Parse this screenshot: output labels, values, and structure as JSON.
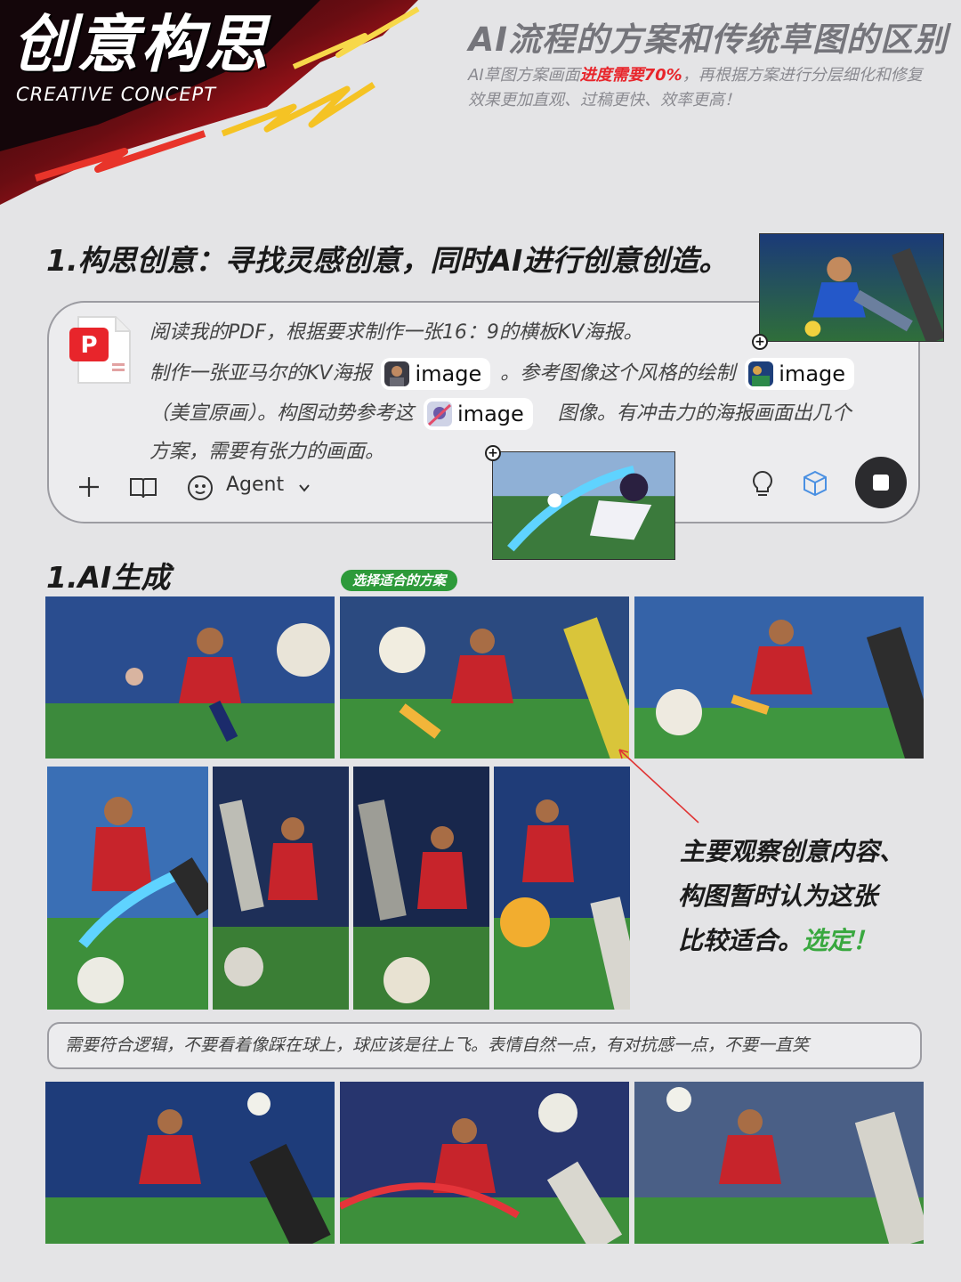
{
  "header": {
    "title": "创意构思",
    "subtitle": "CREATIVE CONCEPT",
    "right_title": "AI流程的方案和传统草图的区别",
    "desc_prefix": "AI草图方案画面",
    "desc_highlight": "进度需要70%",
    "desc_suffix": "，再根据方案进行分层细化和修复",
    "desc_line2": "效果更加直观、过稿更快、效率更高！"
  },
  "section1": {
    "heading": "1.构思创意：寻找灵感创意，同时AI进行创意创造。"
  },
  "prompt": {
    "line1": "阅读我的PDF，根据要求制作一张16：9的横板KV海报。",
    "line2_a": "制作一张亚马尔的KV海报",
    "chip1": "image",
    "line2_b": "。参考图像这个风格的绘制",
    "chip2": "image",
    "line3_a": "（美宣原画）。构图动势参考这",
    "chip3": "image",
    "line3_b": "图像。有冲击力的海报画面出几个",
    "line4": "方案，需要有张力的画面。",
    "agent_label": "Agent"
  },
  "section2": {
    "heading": "1.AI生成",
    "badge": "选择适合的方案"
  },
  "note": {
    "line1": "主要观察创意内容、",
    "line2": "构图暂时认为这张",
    "line3_prefix": "比较适合。",
    "line3_highlight": "选定！"
  },
  "feedback": "需要符合逻辑，不要看着像踩在球上，球应该是往上飞。表情自然一点，有对抗感一点，不要一直笑",
  "colors": {
    "background": "#e4e4e6",
    "accent_red": "#e8252b",
    "accent_green": "#39a83f",
    "badge_green": "#2d9a3a"
  }
}
